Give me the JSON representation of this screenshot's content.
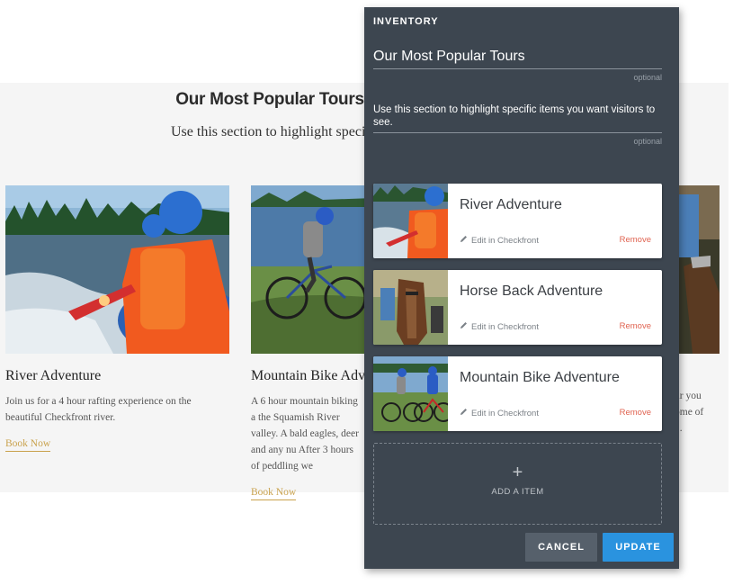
{
  "site": {
    "title": "Our Most Popular Tours",
    "subtitle": "Use this section to highlight speci",
    "tours": [
      {
        "title": "River Adventure",
        "desc": "Join us for a 4 hour rafting experience on the beautiful Checkfront river.",
        "link": "Book Now"
      },
      {
        "title": "Mountain Bike Adve",
        "desc": "A 6 hour mountain biking a the Squamish River valley. A bald eagles, deer and any nu After 3 hours of peddling we",
        "link": "Book Now"
      }
    ],
    "third_desc": "ur you ome of ..."
  },
  "panel": {
    "label": "INVENTORY",
    "title_value": "Our Most Popular Tours",
    "title_hint": "optional",
    "desc_value": "Use this section to highlight specific items you want visitors to see.",
    "desc_hint": "optional",
    "items": [
      {
        "name": "River Adventure",
        "edit": "Edit in Checkfront",
        "remove": "Remove"
      },
      {
        "name": "Horse Back Adventure",
        "edit": "Edit in Checkfront",
        "remove": "Remove"
      },
      {
        "name": "Mountain Bike Adventure",
        "edit": "Edit in Checkfront",
        "remove": "Remove"
      }
    ],
    "add_label": "ADD A ITEM",
    "add_icon": "+",
    "cancel_label": "CANCEL",
    "update_label": "UPDATE"
  },
  "colors": {
    "panel_bg": "#3d4650",
    "accent_blue": "#2a93df",
    "remove_red": "#e06452",
    "link_gold": "#c9a24d"
  }
}
